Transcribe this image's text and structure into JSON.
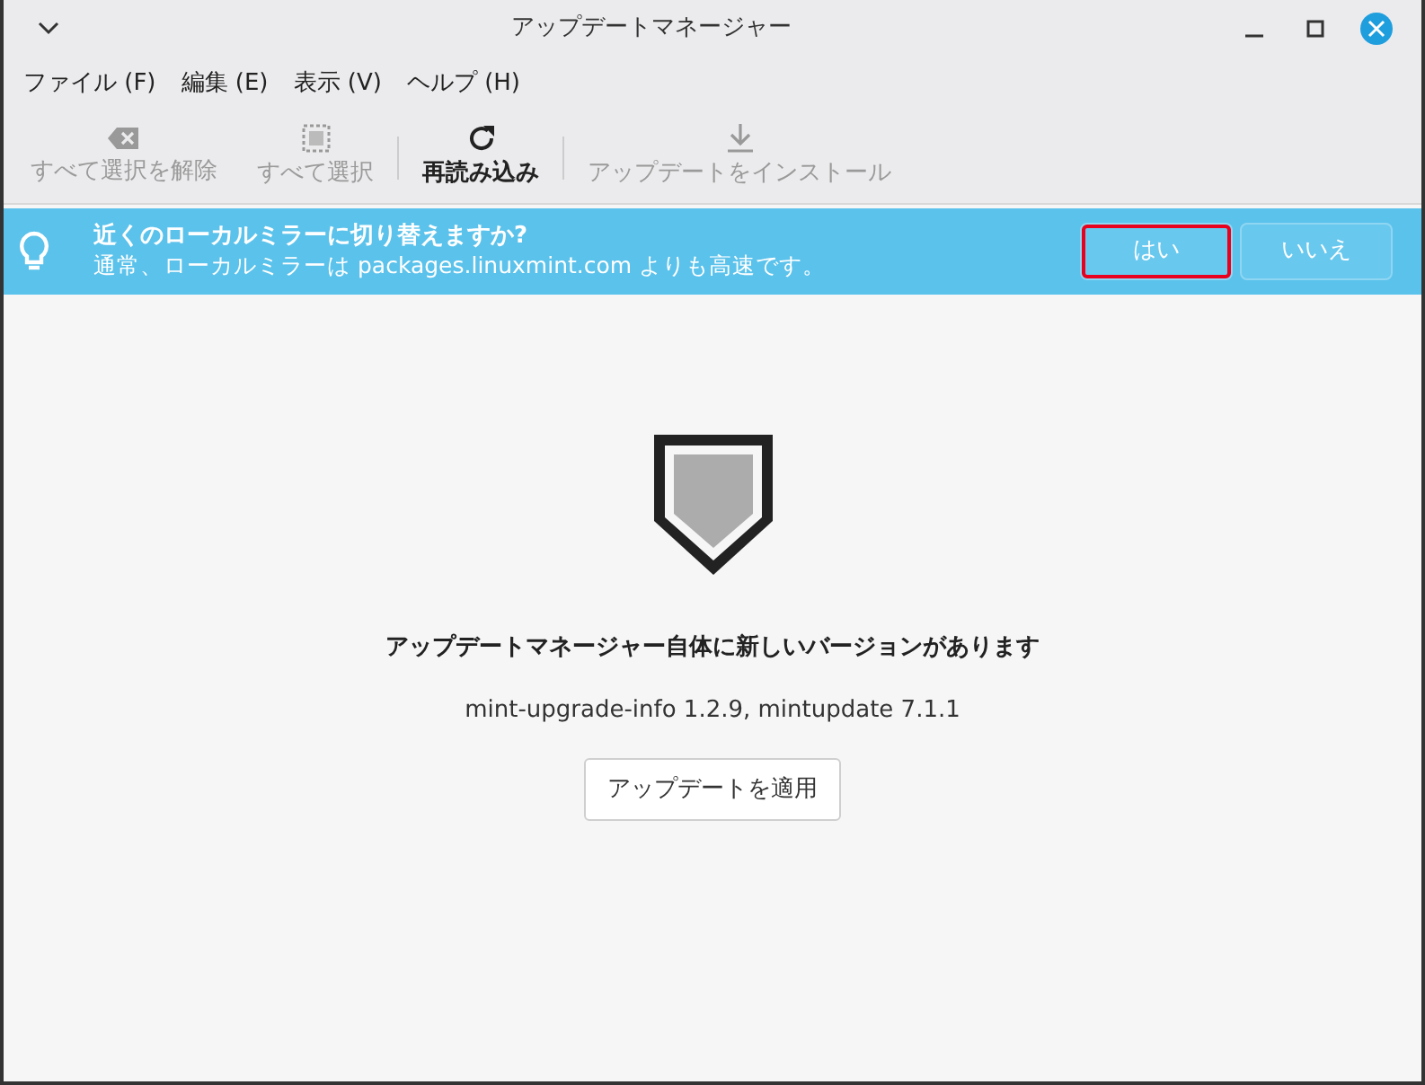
{
  "window": {
    "title": "アップデートマネージャー"
  },
  "menu": [
    {
      "label": "ファイル (F)"
    },
    {
      "label": "編集 (E)"
    },
    {
      "label": "表示 (V)"
    },
    {
      "label": "ヘルプ (H)"
    }
  ],
  "toolbar": [
    {
      "label": "すべて選択を解除",
      "kind": "clear",
      "disabled": true
    },
    {
      "label": "すべて選択",
      "kind": "selectall",
      "disabled": true
    },
    {
      "label": "再読み込み",
      "kind": "refresh",
      "disabled": false
    },
    {
      "label": "アップデートをインストール",
      "kind": "install",
      "disabled": true
    }
  ],
  "infobar": {
    "title": "近くのローカルミラーに切り替えますか?",
    "message": "通常、ローカルミラーは packages.linuxmint.com よりも高速です。",
    "buttons": [
      {
        "label": "はい",
        "highlighted": true
      },
      {
        "label": "いいえ",
        "highlighted": false
      }
    ]
  },
  "content": {
    "heading": "アップデートマネージャー自体に新しいバージョンがあります",
    "versions": "mint-upgrade-info 1.2.9, mintupdate 7.1.1",
    "button": "アップデートを適用"
  }
}
